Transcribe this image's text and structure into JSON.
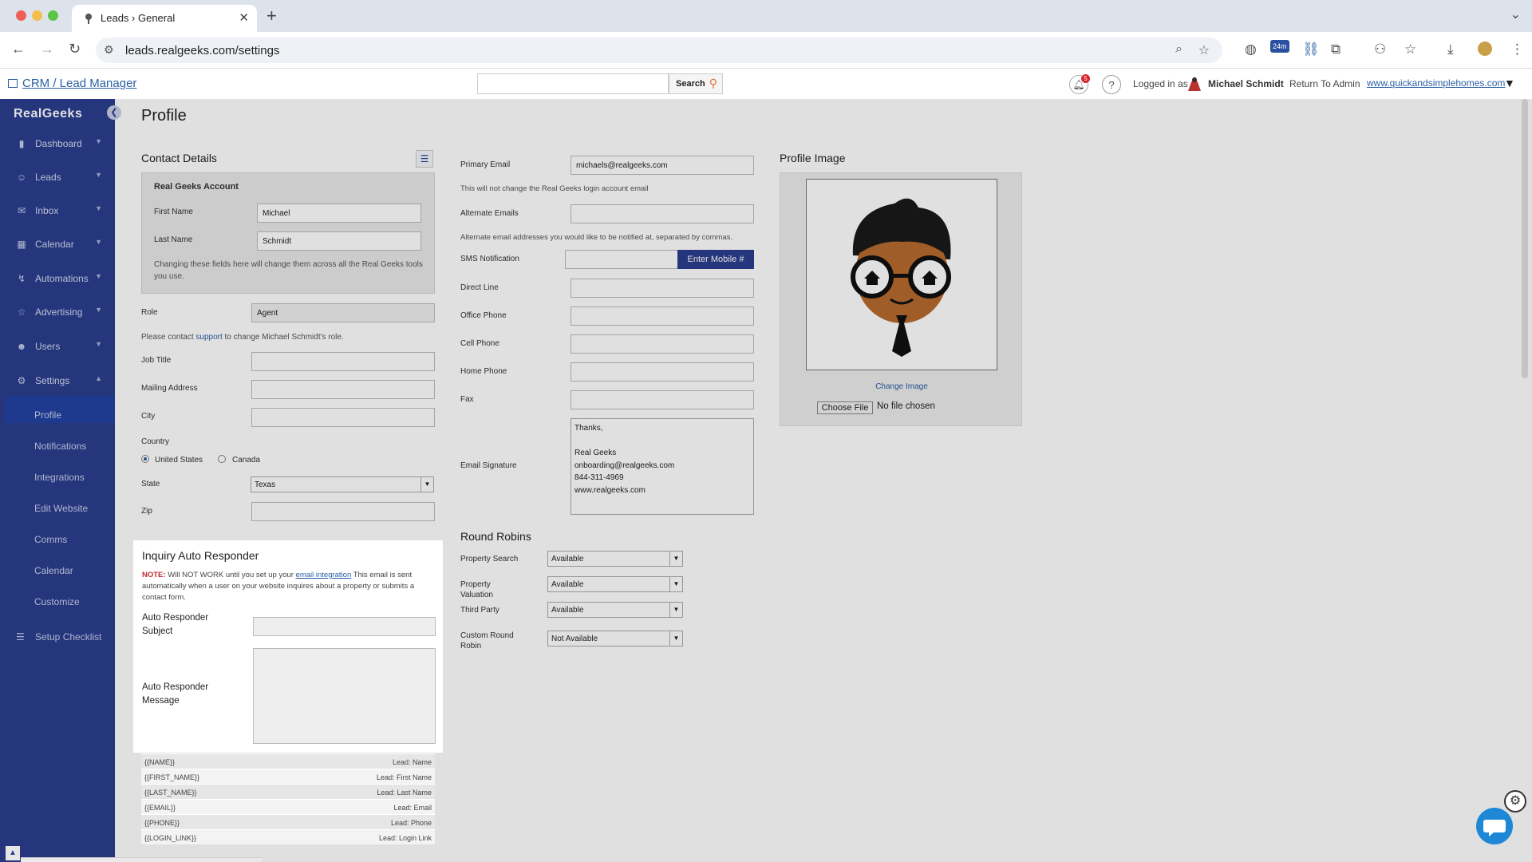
{
  "browser": {
    "tab_title": "Leads › General",
    "url": "leads.realgeeks.com/settings",
    "extension_badge": "24m"
  },
  "header": {
    "crm_link": "CRM / Lead Manager",
    "search_button": "Search",
    "notification_count": "5",
    "logged_in_label": "Logged in as",
    "user_name": "Michael Schmidt",
    "return_link": "Return To Admin",
    "site_link": "www.quickandsimplehomes.com"
  },
  "sidebar": {
    "logo": "RealGeeks",
    "items": [
      {
        "label": "Dashboard",
        "icon": "chart-icon"
      },
      {
        "label": "Leads",
        "icon": "people-icon"
      },
      {
        "label": "Inbox",
        "icon": "envelope-icon"
      },
      {
        "label": "Calendar",
        "icon": "calendar-icon"
      },
      {
        "label": "Automations",
        "icon": "automation-icon"
      },
      {
        "label": "Advertising",
        "icon": "star-icon"
      },
      {
        "label": "Users",
        "icon": "user-icon"
      },
      {
        "label": "Settings",
        "icon": "gear-icon"
      }
    ],
    "sub_items": [
      "Profile",
      "Notifications",
      "Integrations",
      "Edit Website",
      "Comms",
      "Calendar",
      "Customize"
    ],
    "setup": "Setup Checklist"
  },
  "page": {
    "title": "Profile"
  },
  "contact": {
    "heading": "Contact Details",
    "account_heading": "Real Geeks Account",
    "first_name_label": "First Name",
    "first_name": "Michael",
    "last_name_label": "Last Name",
    "last_name": "Schmidt",
    "account_note": "Changing these fields here will change them across all the Real Geeks tools you use.",
    "role_label": "Role",
    "role": "Agent",
    "role_note_pre": "Please contact",
    "role_note_link": "support",
    "role_note_post": "to change Michael Schmidt's role.",
    "job_title_label": "Job Title",
    "mailing_label": "Mailing Address",
    "city_label": "City",
    "country_label": "Country",
    "country_us": "United States",
    "country_ca": "Canada",
    "state_label": "State",
    "state": "Texas",
    "zip_label": "Zip"
  },
  "inquiry": {
    "title": "Inquiry Auto Responder",
    "note_bold": "NOTE:",
    "note_a": "Will NOT WORK until you set up your",
    "note_link": "email integration",
    "note_b": "This email is sent automatically when a user on your website inquires about a property or submits a contact form.",
    "subject_label": "Auto Responder Subject",
    "message_label": "Auto Responder Message"
  },
  "tokens": [
    {
      "key": "{{NAME}}",
      "value": "Lead: Name"
    },
    {
      "key": "{{FIRST_NAME}}",
      "value": "Lead: First Name"
    },
    {
      "key": "{{LAST_NAME}}",
      "value": "Lead: Last Name"
    },
    {
      "key": "{{EMAIL}}",
      "value": "Lead: Email"
    },
    {
      "key": "{{PHONE}}",
      "value": "Lead: Phone"
    },
    {
      "key": "{{LOGIN_LINK}}",
      "value": "Lead: Login Link"
    }
  ],
  "emails": {
    "primary_label": "Primary Email",
    "primary": "michaels@realgeeks.com",
    "primary_note": "This will not change the Real Geeks login account email",
    "alternate_label": "Alternate Emails",
    "alternate_note": "Alternate email addresses you would like to be notified at, separated by commas.",
    "sms_label": "SMS Notification",
    "sms_button": "Enter Mobile #",
    "direct_label": "Direct Line",
    "office_label": "Office Phone",
    "cell_label": "Cell Phone",
    "home_label": "Home Phone",
    "fax_label": "Fax",
    "signature_label": "Email Signature",
    "signature": "Thanks,\n\nReal Geeks\nonboarding@realgeeks.com\n844-311-4969\nwww.realgeeks.com"
  },
  "round_robins": {
    "heading": "Round Robins",
    "rows": [
      {
        "label": "Property Search",
        "value": "Available"
      },
      {
        "label": "Property Valuation",
        "value": "Available"
      },
      {
        "label": "Third Party",
        "value": "Available"
      },
      {
        "label": "Custom Round Robin",
        "value": "Not Available"
      }
    ]
  },
  "profile_image": {
    "heading": "Profile Image",
    "change": "Change Image",
    "choose": "Choose File",
    "no_file": "No file chosen"
  },
  "colors": {
    "sidebar": "#2b3e8f",
    "active": "#2342a3",
    "link": "#2a5fa5",
    "warning": "#c0272d"
  }
}
